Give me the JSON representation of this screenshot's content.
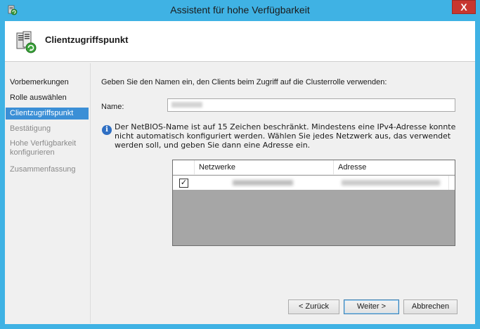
{
  "window": {
    "title": "Assistent für hohe Verfügbarkeit",
    "close_symbol": "X"
  },
  "header": {
    "title": "Clientzugriffspunkt",
    "icon": "cluster-server-icon"
  },
  "sidebar": {
    "steps": [
      {
        "label": "Vorbemerkungen",
        "state": "normal"
      },
      {
        "label": "Rolle auswählen",
        "state": "normal"
      },
      {
        "label": "Clientzugriffspunkt",
        "state": "active"
      },
      {
        "label": "Bestätigung",
        "state": "disabled"
      },
      {
        "label": "Hohe Verfügbarkeit konfigurieren",
        "state": "disabled"
      },
      {
        "label": "Zusammenfassung",
        "state": "disabled"
      }
    ]
  },
  "main": {
    "intro": "Geben Sie den Namen ein, den Clients beim Zugriff auf die Clusterrolle verwenden:",
    "name_label": "Name:",
    "info_text": "Der NetBIOS-Name ist auf 15 Zeichen beschränkt.  Mindestens eine IPv4-Adresse konnte nicht automatisch konfiguriert werden. Wählen Sie jedes Netzwerk aus, das verwendet werden soll, und geben Sie dann eine Adresse ein.",
    "info_icon": "info-icon",
    "network_table": {
      "headers": {
        "networks": "Netzwerke",
        "address": "Adresse"
      },
      "rows": [
        {
          "checked": true,
          "check_symbol": "✓"
        }
      ]
    }
  },
  "buttons": {
    "back": "< Zurück",
    "next": "Weiter >",
    "cancel": "Abbrechen"
  },
  "colors": {
    "title_bar": "#3fb2e4",
    "active_step": "#3b8fd6",
    "close_button": "#c7372f"
  }
}
